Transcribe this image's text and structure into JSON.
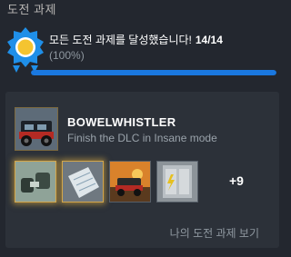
{
  "section": {
    "title": "도전 과제"
  },
  "progress": {
    "message": "모든 도전 과제를 달성했습니다!",
    "count": "14/14",
    "percent": "(100%)",
    "fraction": 1.0
  },
  "featured": {
    "name": "BOWELWHISTLER",
    "description": "Finish the DLC in Insane mode",
    "icon": "jeep-achievement-icon"
  },
  "thumbnails": [
    {
      "icon": "binoculars-achievement-icon",
      "rare": true
    },
    {
      "icon": "map-sheet-achievement-icon",
      "rare": true
    },
    {
      "icon": "jeep-sunset-achievement-icon",
      "rare": false
    },
    {
      "icon": "fuse-box-achievement-icon",
      "rare": false
    }
  ],
  "more": {
    "label": "+9"
  },
  "view_link": {
    "label": "나의 도전 과제 보기"
  },
  "colors": {
    "background": "#23272f",
    "card": "#2c3139",
    "progress": "#1a78e0",
    "badge_blue": "#1f8fe8",
    "badge_gold": "#f4c430",
    "rare_glow": "#d3a64a"
  }
}
